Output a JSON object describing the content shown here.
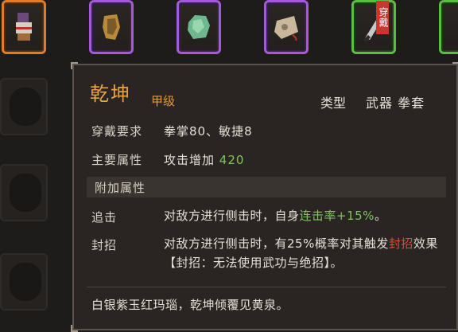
{
  "inventory": {
    "slots": [
      {
        "name": "gauntlet-item",
        "rarity": "orange"
      },
      {
        "name": "golden-claw-item",
        "rarity": "purple"
      },
      {
        "name": "jade-stone-item",
        "rarity": "purple"
      },
      {
        "name": "pouch-item",
        "rarity": "purple"
      },
      {
        "name": "blade-item",
        "rarity": "green",
        "tag": "穿戴"
      },
      {
        "name": "partial-item",
        "rarity": "green"
      }
    ]
  },
  "tooltip": {
    "name": "乾坤",
    "grade": "甲级",
    "type_label": "类型",
    "type_value": "武器 拳套",
    "requirement": {
      "label": "穿戴要求",
      "value": "拳掌80、敏捷8"
    },
    "main_attr": {
      "label": "主要属性",
      "value_prefix": "攻击增加 ",
      "value_num": "420"
    },
    "extra_section": "附加属性",
    "effects": [
      {
        "label": "追击",
        "parts": [
          {
            "text": "对敌方进行侧击时，自身",
            "color": "white"
          },
          {
            "text": "连击率+15%",
            "color": "green"
          },
          {
            "text": "。",
            "color": "white"
          }
        ]
      },
      {
        "label": "封招",
        "parts": [
          {
            "text": "对敌方进行侧击时，有25%概率对其触发",
            "color": "white"
          },
          {
            "text": "封招",
            "color": "red"
          },
          {
            "text": "效果【封招：无法使用武功与绝招】。",
            "color": "white"
          }
        ]
      }
    ],
    "flavor": "白银紫玉红玛瑙，乾坤倾覆见黄泉。"
  },
  "colors": {
    "name": "#e8a33f",
    "positive": "#7fc45d",
    "negative": "#e04a3a"
  }
}
